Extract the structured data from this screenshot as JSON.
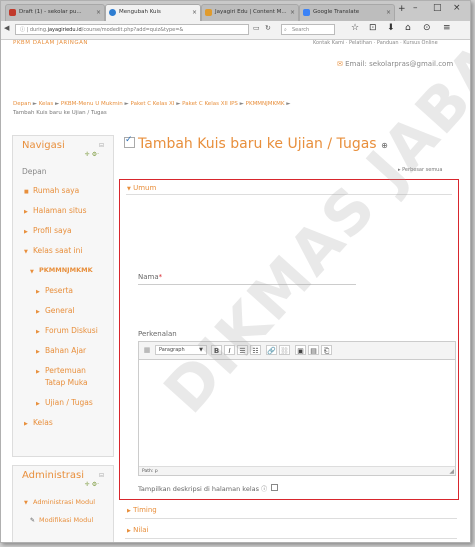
{
  "browser": {
    "tabs": [
      {
        "label": "Draft (1) - sekolar pu...",
        "icon_color": "#c1392b"
      },
      {
        "label": "Mengubah Kuis",
        "icon_color": "#2e7dd1"
      },
      {
        "label": "Jayagiri Edu | Content M...",
        "icon_color": "#e09b2d"
      },
      {
        "label": "Google Translate",
        "icon_color": "#3b82f6"
      }
    ],
    "new_tab": "+",
    "window_controls": [
      "–",
      "□",
      "×"
    ],
    "url_prefix": "ⓘ | during.",
    "url_domain": "jayagiriedu.id",
    "url_rest": "/course/modedit.php?add=quiz&type=&",
    "search_placeholder": "Search",
    "toolbar_icons": [
      "☆",
      "⊡",
      "⬇",
      "⌂",
      "⊙",
      "≡"
    ]
  },
  "site": {
    "name": "PKBM DALAM JARINGAN",
    "contact": "Kontak Kami · Pelatihan · Panduan · Kursus Online",
    "email_icon": "✉",
    "email": "Email: sekolarpras@gmail.com"
  },
  "breadcrumb": {
    "items": [
      "Depan",
      "Kelas",
      "PKBM-Menu U Mukmin",
      "Paket C Kelas XI",
      "Paket C Kelas XII IPS",
      "PKMMNJMKMK"
    ],
    "separator": "►",
    "last": "Tambah Kuis baru ke Ujian / Tugas"
  },
  "navigation": {
    "title": "Navigasi",
    "controls": "⊟",
    "mini": "✛ ⚙·",
    "items": [
      {
        "label": "Depan",
        "level": 0,
        "bullet": ""
      },
      {
        "label": "Rumah saya",
        "level": 1,
        "bullet": "■"
      },
      {
        "label": "Halaman situs",
        "level": 1,
        "bullet": "▶"
      },
      {
        "label": "Profil saya",
        "level": 1,
        "bullet": "▶"
      },
      {
        "label": "Kelas saat ini",
        "level": 1,
        "bullet": "▼"
      },
      {
        "label": "PKMMNJMKMK",
        "level": 2,
        "bullet": "▼"
      },
      {
        "label": "Peserta",
        "level": 3,
        "bullet": "▶"
      },
      {
        "label": "General",
        "level": 3,
        "bullet": "▶"
      },
      {
        "label": "Forum Diskusi",
        "level": 3,
        "bullet": "▶"
      },
      {
        "label": "Bahan Ajar",
        "level": 3,
        "bullet": "▶"
      },
      {
        "label": "Pertemuan",
        "level": 3,
        "bullet": "▶"
      },
      {
        "label": "Tatap Muka",
        "level": 3,
        "bullet": ""
      },
      {
        "label": "Ujian / Tugas",
        "level": 3,
        "bullet": "▶"
      },
      {
        "label": "Kelas",
        "level": 1,
        "bullet": "▶"
      }
    ]
  },
  "administration": {
    "title": "Administrasi",
    "controls": "⊟",
    "mini": "✛ ⚙·",
    "items": [
      {
        "label": "Administrasi Modul",
        "bullet": "▼"
      },
      {
        "label": "Modifikasi Modul",
        "bullet": "✎"
      }
    ]
  },
  "main": {
    "title": "Tambah Kuis baru ke Ujian / Tugas",
    "help_icon": "⊕",
    "expand_all": "▸ Perbesar semua",
    "general_section": "Umum",
    "name_label": "Nama",
    "required_mark": "*",
    "name_value": "",
    "description_label": "Perkenalan",
    "editor": {
      "format_value": "Paragraph",
      "buttons": [
        "B",
        "I",
        "☰",
        "☷",
        "🔗",
        "⛓",
        "▣",
        "▤",
        "⎗"
      ],
      "status_path": "Path: p"
    },
    "show_description_label": "Tampilkan deskripsi di halaman kelas",
    "show_description_checked": false,
    "collapsed_sections": [
      "Timing",
      "Nilai"
    ]
  },
  "watermark": "DIKMAS JABAR"
}
